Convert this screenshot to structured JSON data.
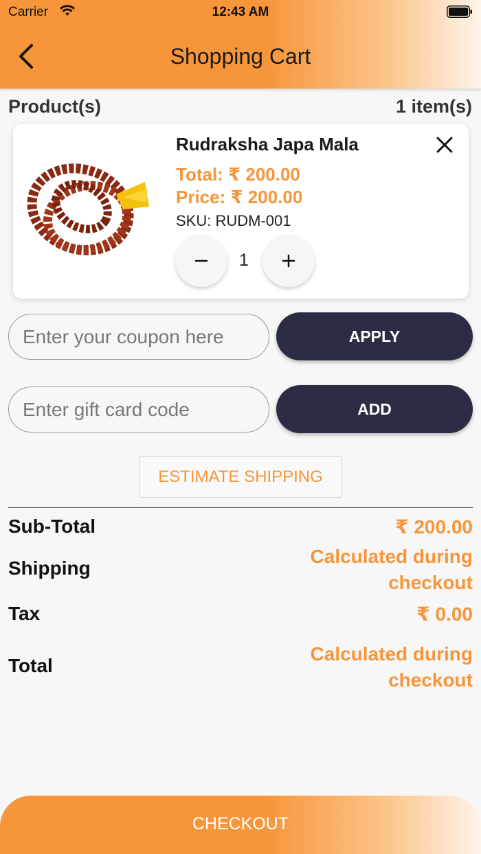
{
  "status_bar": {
    "carrier": "Carrier",
    "time": "12:43 AM"
  },
  "header": {
    "title": "Shopping Cart"
  },
  "cart": {
    "products_label": "Product(s)",
    "items_count": "1 item(s)",
    "items": [
      {
        "name": "Rudraksha Japa Mala",
        "total": "Total: ₹ 200.00",
        "price": "Price: ₹ 200.00",
        "sku": "SKU: RUDM-001",
        "quantity": "1"
      }
    ]
  },
  "coupon": {
    "placeholder": "Enter your coupon here",
    "button_label": "APPLY"
  },
  "gift_card": {
    "placeholder": "Enter gift card code",
    "button_label": "ADD"
  },
  "estimate_shipping_label": "ESTIMATE SHIPPING",
  "summary": {
    "subtotal_label": "Sub-Total",
    "subtotal_value": "₹ 200.00",
    "shipping_label": "Shipping",
    "shipping_value_line1": "Calculated during",
    "shipping_value_line2": "checkout",
    "tax_label": "Tax",
    "tax_value": "₹ 0.00",
    "total_label": "Total",
    "total_value_line1": "Calculated during",
    "total_value_line2": "checkout"
  },
  "checkout_label": "CHECKOUT",
  "colors": {
    "accent": "#f7953a",
    "dark_button": "#2c2c45"
  },
  "icons": {
    "back": "chevron-left-icon",
    "remove": "close-icon",
    "decrement": "minus-icon",
    "increment": "plus-icon"
  }
}
